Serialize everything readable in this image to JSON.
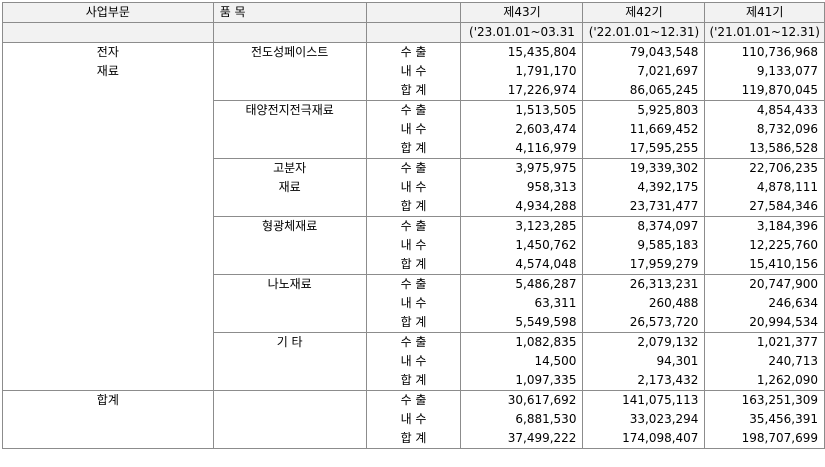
{
  "header": {
    "division": "사업부문",
    "item": "품 목",
    "periods": [
      {
        "name": "제43기",
        "range": "('23.01.01~03.31"
      },
      {
        "name": "제42기",
        "range": "('22.01.01~12.31)"
      },
      {
        "name": "제41기",
        "range": "('21.01.01~12.31)"
      }
    ]
  },
  "rows": [
    {
      "division": "전자",
      "product": "전도성페이스트",
      "type": "수 출",
      "values": [
        "15,435,804",
        "79,043,548",
        "110,736,968"
      ]
    },
    {
      "division": "재료",
      "product": "",
      "type": "내 수",
      "values": [
        "1,791,170",
        "7,021,697",
        "9,133,077"
      ]
    },
    {
      "division": "",
      "product": "",
      "type": "합 계",
      "values": [
        "17,226,974",
        "86,065,245",
        "119,870,045"
      ]
    },
    {
      "division": "",
      "product": "태양전지전극재료",
      "type": "수 출",
      "values": [
        "1,513,505",
        "5,925,803",
        "4,854,433"
      ]
    },
    {
      "division": "",
      "product": "",
      "type": "내 수",
      "values": [
        "2,603,474",
        "11,669,452",
        "8,732,096"
      ]
    },
    {
      "division": "",
      "product": "",
      "type": "합 계",
      "values": [
        "4,116,979",
        "17,595,255",
        "13,586,528"
      ]
    },
    {
      "division": "",
      "product": "고분자",
      "type": "수 출",
      "values": [
        "3,975,975",
        "19,339,302",
        "22,706,235"
      ]
    },
    {
      "division": "",
      "product": "재료",
      "type": "내 수",
      "values": [
        "958,313",
        "4,392,175",
        "4,878,111"
      ]
    },
    {
      "division": "",
      "product": "",
      "type": "합 계",
      "values": [
        "4,934,288",
        "23,731,477",
        "27,584,346"
      ]
    },
    {
      "division": "",
      "product": "형광체재료",
      "type": "수 출",
      "values": [
        "3,123,285",
        "8,374,097",
        "3,184,396"
      ]
    },
    {
      "division": "",
      "product": "",
      "type": "내 수",
      "values": [
        "1,450,762",
        "9,585,183",
        "12,225,760"
      ]
    },
    {
      "division": "",
      "product": "",
      "type": "합 계",
      "values": [
        "4,574,048",
        "17,959,279",
        "15,410,156"
      ]
    },
    {
      "division": "",
      "product": "나노재료",
      "type": "수 출",
      "values": [
        "5,486,287",
        "26,313,231",
        "20,747,900"
      ]
    },
    {
      "division": "",
      "product": "",
      "type": "내 수",
      "values": [
        "63,311",
        "260,488",
        "246,634"
      ]
    },
    {
      "division": "",
      "product": "",
      "type": "합 계",
      "values": [
        "5,549,598",
        "26,573,720",
        "20,994,534"
      ]
    },
    {
      "division": "",
      "product": "기 타",
      "type": "수 출",
      "values": [
        "1,082,835",
        "2,079,132",
        "1,021,377"
      ]
    },
    {
      "division": "",
      "product": "",
      "type": "내 수",
      "values": [
        "14,500",
        "94,301",
        "240,713"
      ]
    },
    {
      "division": "",
      "product": "",
      "type": "합 계",
      "values": [
        "1,097,335",
        "2,173,432",
        "1,262,090"
      ]
    },
    {
      "division": "합계",
      "product": "",
      "type": "수 출",
      "values": [
        "30,617,692",
        "141,075,113",
        "163,251,309"
      ]
    },
    {
      "division": "",
      "product": "",
      "type": "내 수",
      "values": [
        "6,881,530",
        "33,023,294",
        "35,456,391"
      ]
    },
    {
      "division": "",
      "product": "",
      "type": "합 계",
      "values": [
        "37,499,222",
        "174,098,407",
        "198,707,699"
      ]
    }
  ]
}
